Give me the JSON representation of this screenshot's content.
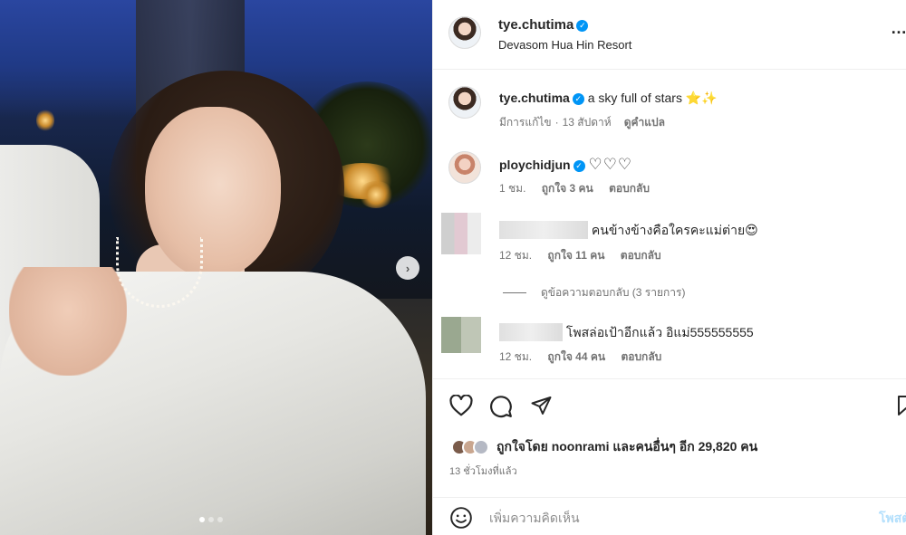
{
  "post": {
    "username": "tye.chutima",
    "location": "Devasom Hua Hin Resort",
    "caption": {
      "username": "tye.chutima",
      "text": "a sky full of stars",
      "emojis": "⭐✨",
      "edited": "มีการแก้ไข",
      "age": "13 สัปดาห์",
      "translate": "ดูคำแปล"
    }
  },
  "comments": [
    {
      "username": "ploychidjun",
      "verified": true,
      "text": "♡♡♡",
      "age": "1 ชม.",
      "likes": "ถูกใจ 3 คน",
      "reply": "ตอบกลับ"
    },
    {
      "username": "",
      "text": "คนข้างข้างคือใครคะแม่ต่าย",
      "emoji": "😍",
      "age": "12 ชม.",
      "likes": "ถูกใจ 11 คน",
      "reply": "ตอบกลับ",
      "view_replies": "ดูข้อความตอบกลับ (3 รายการ)"
    },
    {
      "username": "",
      "text": "โพสล่อเป้าอีกแล้ว อิแม่555555555",
      "age": "12 ชม.",
      "likes": "ถูกใจ 44 คน",
      "reply": "ตอบกลับ"
    }
  ],
  "actions": {
    "liked_by": "ถูกใจโดย noonrami และคนอื่นๆ อีก 29,820 คน",
    "time_ago": "13 ชั่วโมงที่แล้ว",
    "comment_placeholder": "เพิ่มความคิดเห็น",
    "post_label": "โพสต์"
  },
  "carousel": {
    "current_index": 1,
    "total": 3
  },
  "colors": {
    "verified": "#0095f6",
    "link_disabled": "#b2dffc",
    "meta": "#737373"
  },
  "icons": [
    "more-icon",
    "verified-icon",
    "heart-icon",
    "comment-icon",
    "share-icon",
    "bookmark-icon",
    "emoji-icon",
    "chevron-right-icon"
  ]
}
